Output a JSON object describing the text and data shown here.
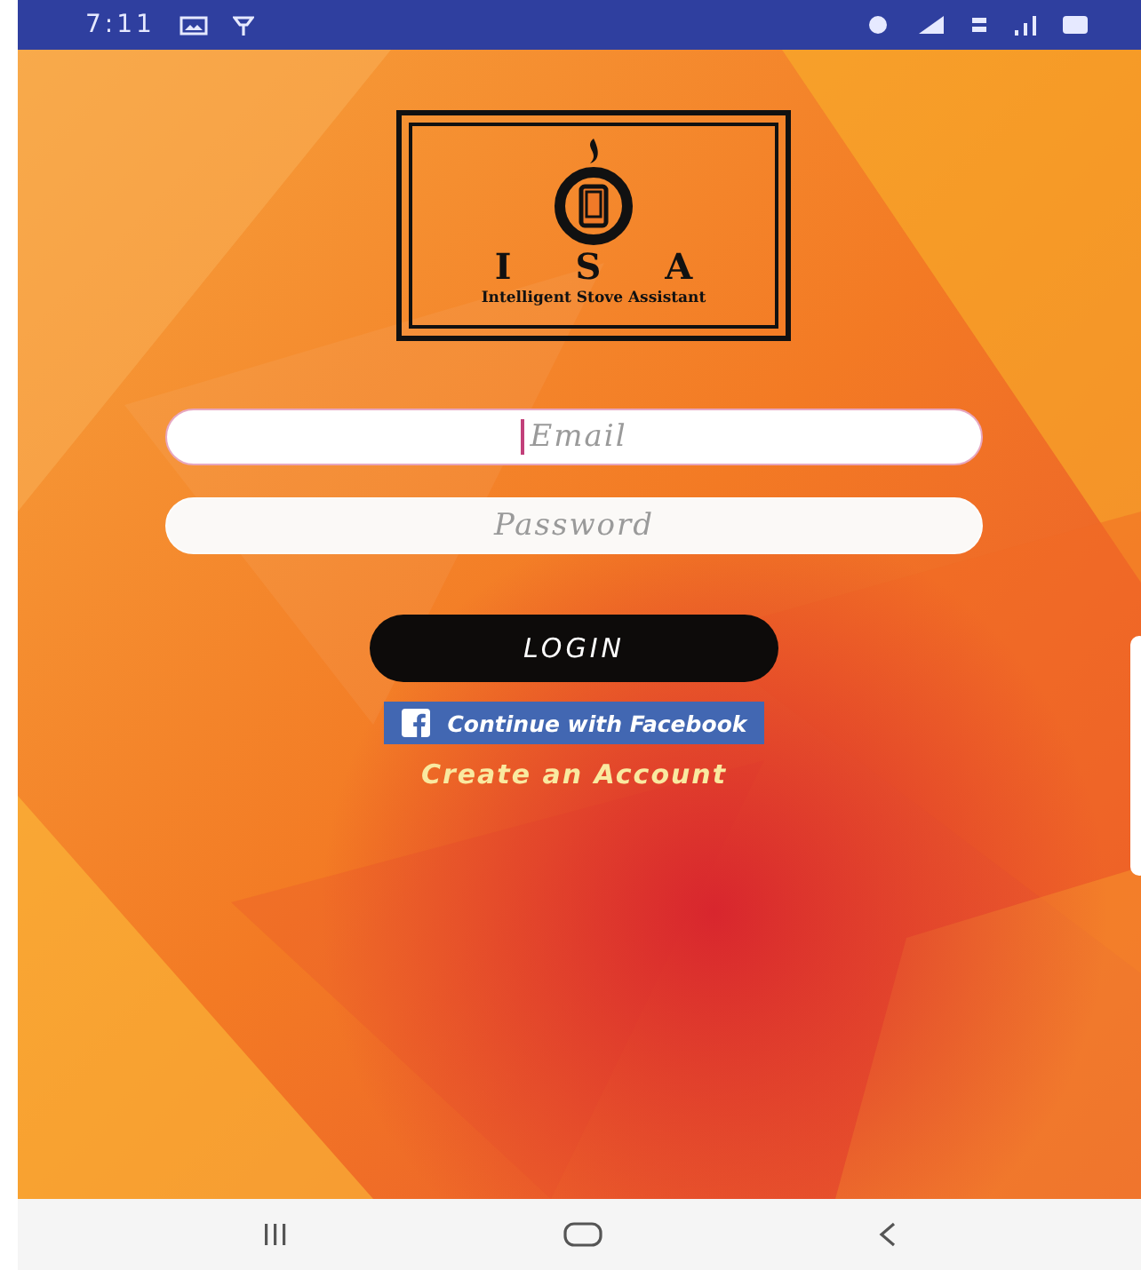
{
  "status_bar": {
    "time": "7:11"
  },
  "logo": {
    "letters": [
      "I",
      "S",
      "A"
    ],
    "subtitle": "Intelligent Stove Assistant"
  },
  "fields": [
    {
      "placeholder": "Email",
      "focused": true
    },
    {
      "placeholder": "Password",
      "focused": false
    }
  ],
  "login_button": "LOGIN",
  "facebook_button": "Continue with Facebook",
  "create_account_link": "Create an Account"
}
